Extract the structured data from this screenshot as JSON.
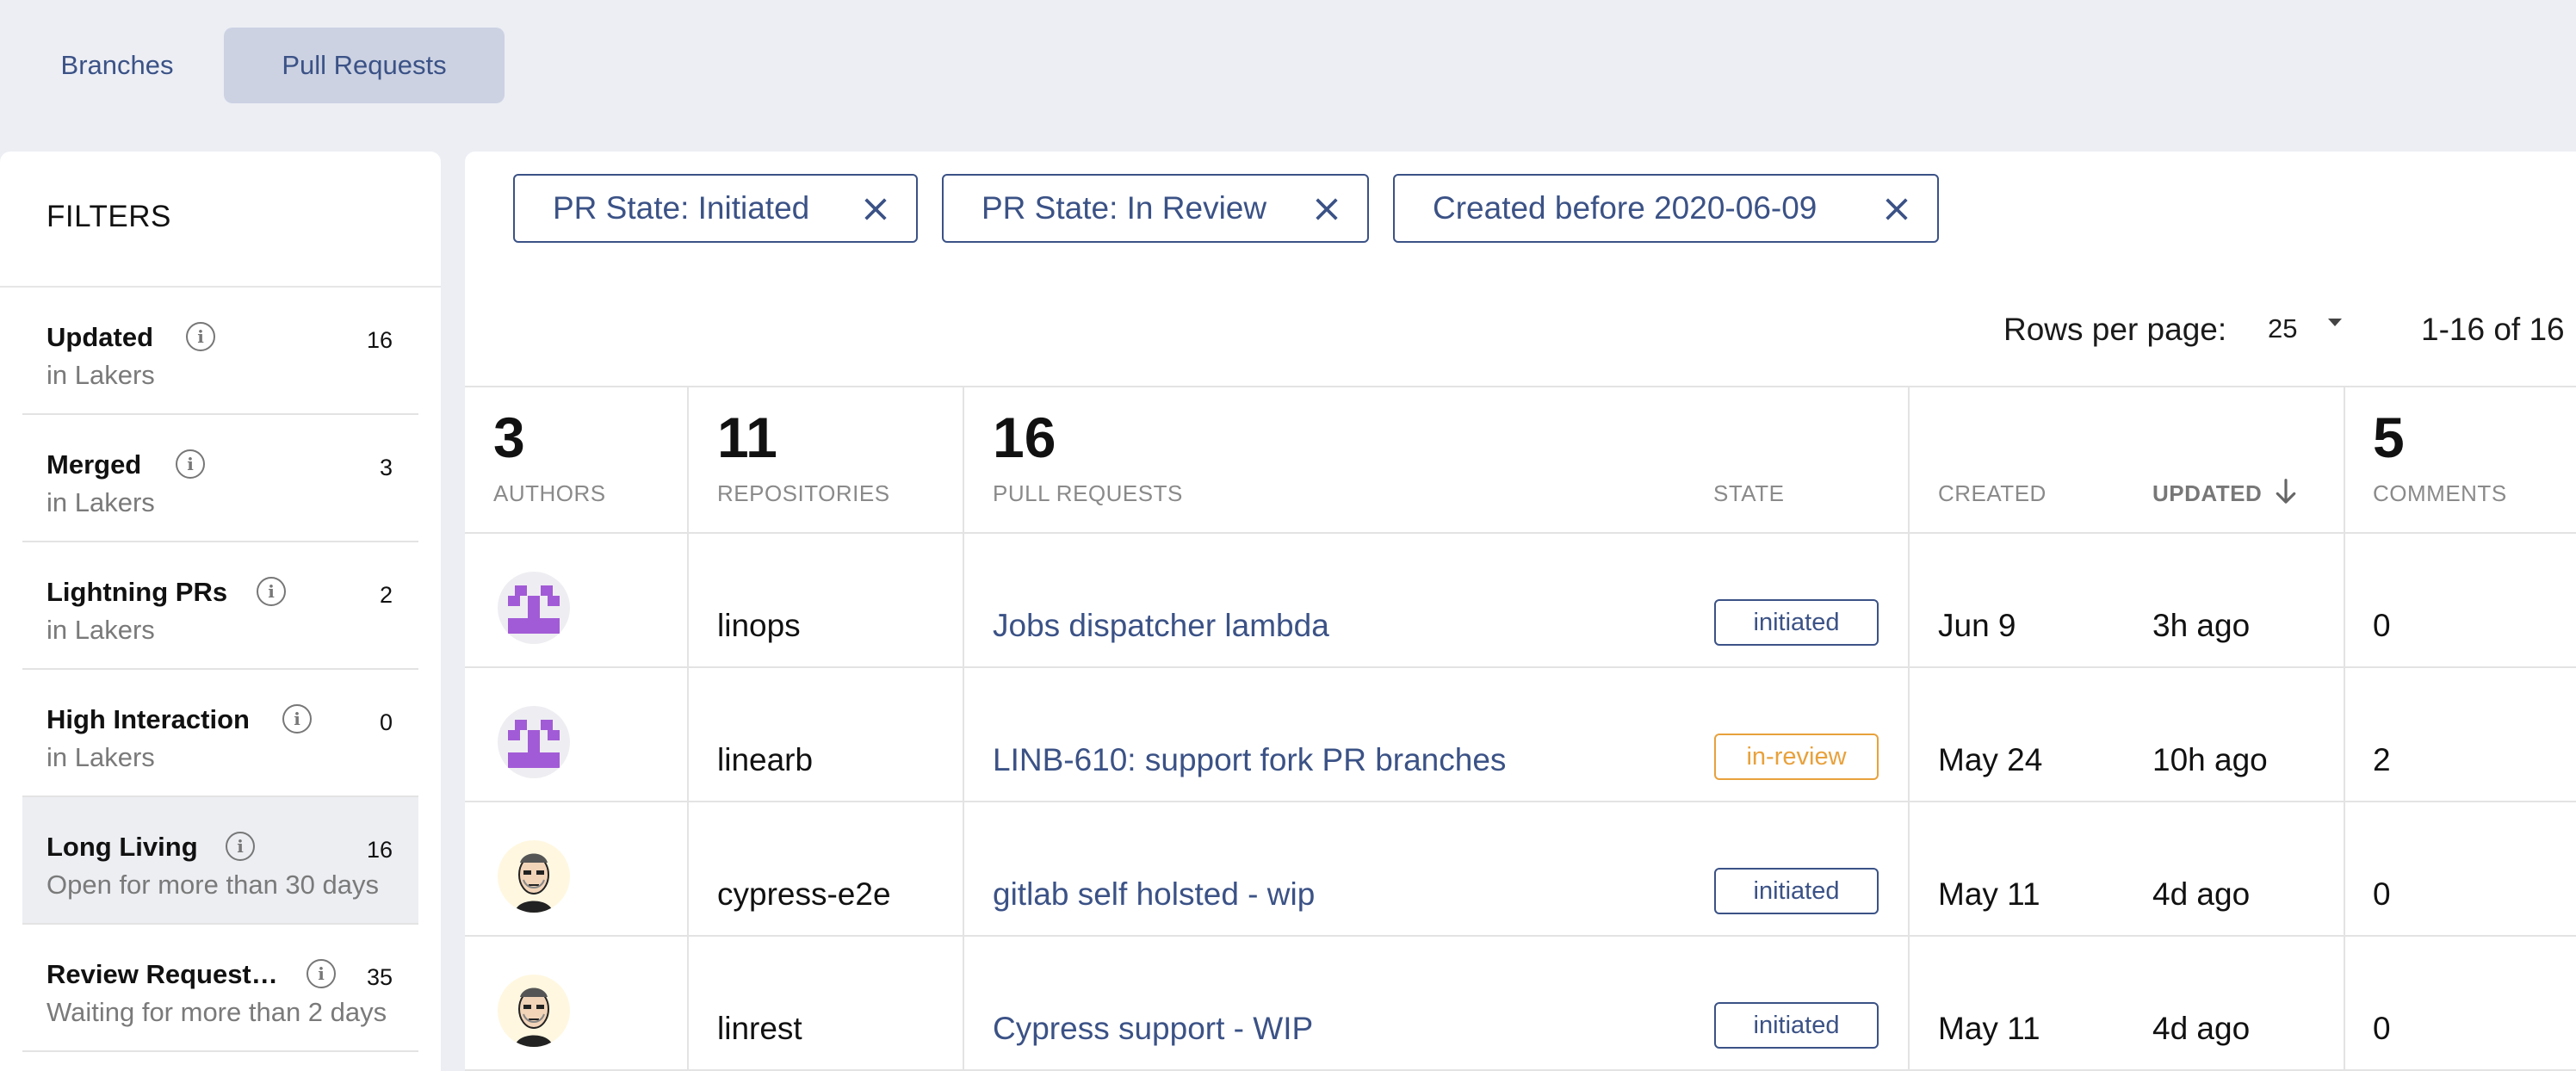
{
  "tabs": [
    {
      "label": "Branches",
      "active": false
    },
    {
      "label": "Pull Requests",
      "active": true
    }
  ],
  "sidebar": {
    "title": "FILTERS",
    "items": [
      {
        "title": "Updated",
        "subtitle": "in Lakers",
        "count": "16",
        "active": false
      },
      {
        "title": "Merged",
        "subtitle": "in Lakers",
        "count": "3",
        "active": false
      },
      {
        "title": "Lightning PRs",
        "subtitle": "in Lakers",
        "count": "2",
        "active": false
      },
      {
        "title": "High Interaction",
        "subtitle": "in Lakers",
        "count": "0",
        "active": false
      },
      {
        "title": "Long Living",
        "subtitle": "Open for more than 30 days",
        "count": "16",
        "active": true
      },
      {
        "title": "Review Request…",
        "subtitle": "Waiting for more than 2 days",
        "count": "35",
        "active": false
      }
    ]
  },
  "chips": [
    {
      "label": "PR State: Initiated"
    },
    {
      "label": "PR State: In Review"
    },
    {
      "label": "Created before 2020-06-09"
    }
  ],
  "pagination": {
    "rows_label": "Rows per page:",
    "rows_value": "25",
    "range": "1-16 of 16"
  },
  "table": {
    "headers": {
      "authors": {
        "count": "3",
        "label": "AUTHORS"
      },
      "repositories": {
        "count": "11",
        "label": "REPOSITORIES"
      },
      "pull_requests": {
        "count": "16",
        "label": "PULL REQUESTS"
      },
      "state": {
        "label": "STATE"
      },
      "created": {
        "label": "CREATED"
      },
      "updated": {
        "label": "UPDATED",
        "sorted": "descending"
      },
      "comments": {
        "count": "5",
        "label": "COMMENTS"
      }
    },
    "rows": [
      {
        "avatar": "identicon-avatar",
        "repo": "linops",
        "title": "Jobs dispatcher lambda",
        "state": "initiated",
        "created": "Jun 9",
        "updated": "3h ago",
        "comments": "0"
      },
      {
        "avatar": "identicon-avatar",
        "repo": "linearb",
        "title": "LINB-610: support fork PR branches",
        "state": "in-review",
        "created": "May 24",
        "updated": "10h ago",
        "comments": "2"
      },
      {
        "avatar": "cartoon-face-avatar",
        "repo": "cypress-e2e",
        "title": "gitlab self holsted - wip",
        "state": "initiated",
        "created": "May 11",
        "updated": "4d ago",
        "comments": "0"
      },
      {
        "avatar": "cartoon-face-avatar",
        "repo": "linrest",
        "title": "Cypress support - WIP",
        "state": "initiated",
        "created": "May 11",
        "updated": "4d ago",
        "comments": "0"
      }
    ]
  },
  "colors": {
    "primary": "#3b5286",
    "review": "#e8a13c",
    "identicon": "#a25bd6",
    "page_bg": "#eceef4",
    "active_tab_bg": "#ccd2e2"
  }
}
